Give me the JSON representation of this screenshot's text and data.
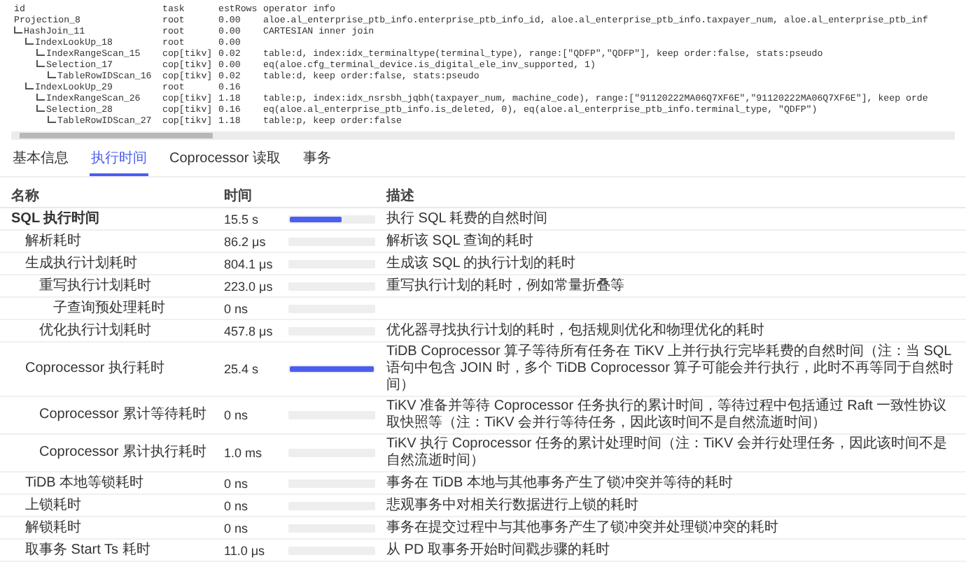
{
  "plan": {
    "columns": [
      "id",
      "task",
      "estRows",
      "operator info"
    ],
    "rows": [
      {
        "id": "Projection_8",
        "task": "root",
        "estRows": "0.00",
        "info": "aloe.al_enterprise_ptb_info.enterprise_ptb_info_id, aloe.al_enterprise_ptb_info.taxpayer_num, aloe.al_enterprise_ptb_inf",
        "children": [
          {
            "id": "HashJoin_11",
            "task": "root",
            "estRows": "0.00",
            "info": "CARTESIAN inner join",
            "children": [
              {
                "id": "IndexLookUp_18",
                "task": "root",
                "estRows": "0.00",
                "children": [
                  {
                    "id": "IndexRangeScan_15",
                    "task": "cop[tikv]",
                    "estRows": "0.02",
                    "info": "table:d, index:idx_terminaltype(terminal_type), range:[\"QDFP\",\"QDFP\"], keep order:false, stats:pseudo"
                  },
                  {
                    "id": "Selection_17",
                    "task": "cop[tikv]",
                    "estRows": "0.00",
                    "info": "eq(aloe.cfg_terminal_device.is_digital_ele_inv_supported, 1)",
                    "children": [
                      {
                        "id": "TableRowIDScan_16",
                        "task": "cop[tikv]",
                        "estRows": "0.02",
                        "info": "table:d, keep order:false, stats:pseudo"
                      }
                    ]
                  }
                ]
              },
              {
                "id": "IndexLookUp_29",
                "task": "root",
                "estRows": "0.16",
                "children": [
                  {
                    "id": "IndexRangeScan_26",
                    "task": "cop[tikv]",
                    "estRows": "1.18",
                    "info": "table:p, index:idx_nsrsbh_jqbh(taxpayer_num, machine_code), range:[\"91120222MA06Q7XF6E\",\"91120222MA06Q7XF6E\"], keep orde"
                  },
                  {
                    "id": "Selection_28",
                    "task": "cop[tikv]",
                    "estRows": "0.16",
                    "info": "eq(aloe.al_enterprise_ptb_info.is_deleted, 0), eq(aloe.al_enterprise_ptb_info.terminal_type, \"QDFP\")",
                    "children": [
                      {
                        "id": "TableRowIDScan_27",
                        "task": "cop[tikv]",
                        "estRows": "1.18",
                        "info": "table:p, keep order:false"
                      }
                    ]
                  }
                ]
              }
            ]
          }
        ]
      }
    ]
  },
  "tabs": [
    {
      "label": "基本信息",
      "selected": false
    },
    {
      "label": "执行时间",
      "selected": true
    },
    {
      "label": "Coprocessor 读取",
      "selected": false
    },
    {
      "label": "事务",
      "selected": false
    }
  ],
  "table": {
    "columns": [
      "名称",
      "时间",
      "描述"
    ],
    "rows": [
      {
        "name": "SQL 执行时间",
        "time": "15.5 s",
        "level": 0.61,
        "description": "执行 SQL 耗费的自然时间",
        "children": [
          {
            "name": "解析耗时",
            "time": "86.2 μs",
            "level": 0,
            "description": "解析该 SQL 查询的耗时"
          },
          {
            "name": "生成执行计划耗时",
            "time": "804.1 μs",
            "level": 0,
            "description": "生成该 SQL 的执行计划的耗时",
            "children": [
              {
                "name": "重写执行计划耗时",
                "time": "223.0 μs",
                "level": 0,
                "description": "重写执行计划的耗时，例如常量折叠等",
                "children": [
                  {
                    "name": "子查询预处理耗时",
                    "time": "0 ns",
                    "level": 0
                  }
                ]
              },
              {
                "name": "优化执行计划耗时",
                "time": "457.8 μs",
                "level": 0,
                "description": "优化器寻找执行计划的耗时，包括规则优化和物理优化的耗时"
              }
            ]
          },
          {
            "name": "Coprocessor 执行耗时",
            "time": "25.4 s",
            "level": 1,
            "description": "TiDB Coprocessor 算子等待所有任务在 TiKV 上并行执行完毕耗费的自然时间（注：当 SQL 语句中包含 JOIN 时，多个 TiDB Coprocessor 算子可能会并行执行，此时不再等同于自然时间）",
            "children": [
              {
                "name": "Coprocessor 累计等待耗时",
                "time": "0 ns",
                "level": 0,
                "description": "TiKV 准备并等待 Coprocessor 任务执行的累计时间，等待过程中包括通过 Raft 一致性协议取快照等（注：TiKV 会并行等待任务，因此该时间不是自然流逝时间）"
              },
              {
                "name": "Coprocessor 累计执行耗时",
                "time": "1.0 ms",
                "level": 0,
                "description": "TiKV 执行 Coprocessor 任务的累计处理时间（注：TiKV 会并行处理任务，因此该时间不是自然流逝时间）"
              }
            ]
          },
          {
            "name": "TiDB 本地等锁耗时",
            "time": "0 ns",
            "level": 0,
            "description": "事务在 TiDB 本地与其他事务产生了锁冲突并等待的耗时"
          },
          {
            "name": "上锁耗时",
            "time": "0 ns",
            "level": 0,
            "description": "悲观事务中对相关行数据进行上锁的耗时"
          },
          {
            "name": "解锁耗时",
            "time": "0 ns",
            "level": 0,
            "description": "事务在提交过程中与其他事务产生了锁冲突并处理锁冲突的耗时"
          },
          {
            "name": "取事务 Start Ts 耗时",
            "time": "11.0 μs",
            "level": 0,
            "description": "从 PD 取事务开始时间戳步骤的耗时"
          }
        ]
      }
    ]
  }
}
